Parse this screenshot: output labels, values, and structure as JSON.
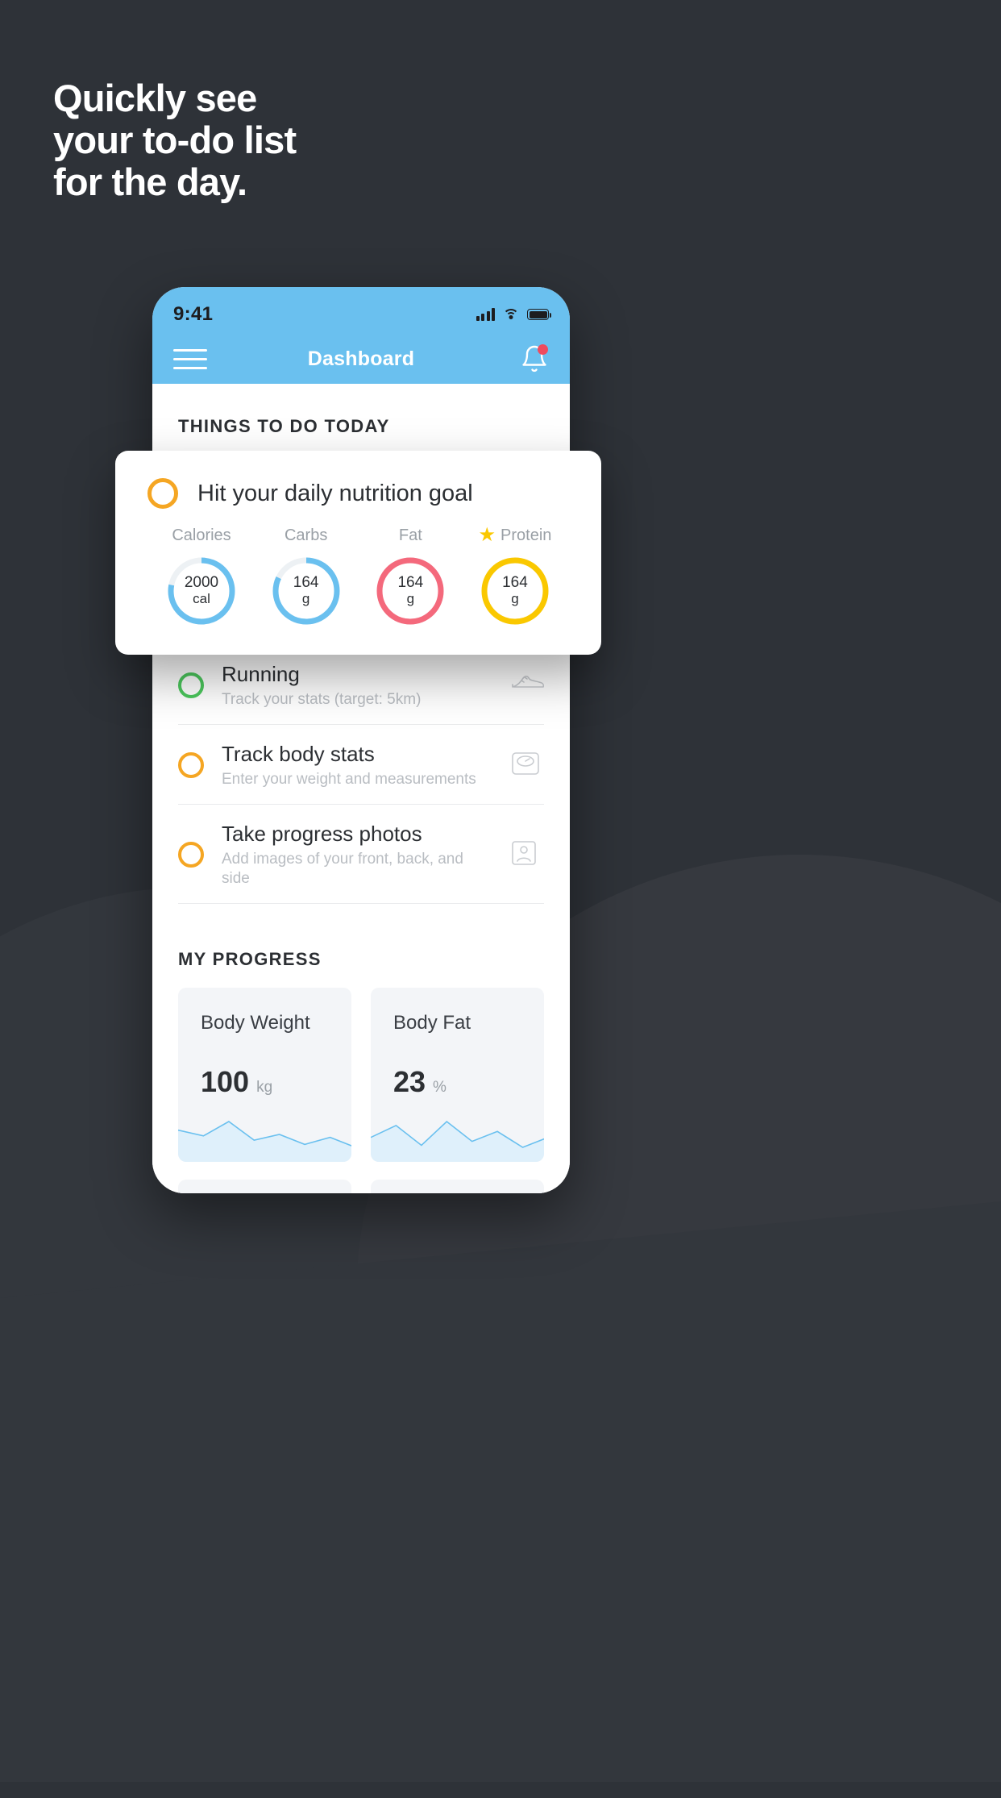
{
  "headline": {
    "lines": [
      "Quickly see",
      "your to-do list",
      "for the day."
    ]
  },
  "colors": {
    "background": "#2e3238",
    "accent_blue": "#6ac0ef",
    "amber": "#f5a623",
    "green": "#4cc85d",
    "red": "#f4697c",
    "yellow": "#fac800",
    "card_grey": "#f3f5f8"
  },
  "phone": {
    "statusbar": {
      "time": "9:41",
      "icons": [
        "signal-icon",
        "wifi-icon",
        "battery-icon"
      ]
    },
    "appbar": {
      "menu_icon": "hamburger-icon",
      "title": "Dashboard",
      "bell_icon": "bell-icon",
      "bell_badge": true
    },
    "things_to_do": {
      "section_title": "THINGS TO DO TODAY",
      "tasks": [
        {
          "title": "Running",
          "subtitle": "Track your stats (target: 5km)",
          "ring_color": "green",
          "icon": "shoe-icon"
        },
        {
          "title": "Track body stats",
          "subtitle": "Enter your weight and measurements",
          "ring_color": "amber",
          "icon": "scale-icon"
        },
        {
          "title": "Take progress photos",
          "subtitle": "Add images of your front, back, and side",
          "ring_color": "amber",
          "icon": "photo-icon"
        }
      ]
    },
    "my_progress": {
      "section_title": "MY PROGRESS",
      "cards": [
        {
          "label": "Body Weight",
          "value": "100",
          "unit": "kg"
        },
        {
          "label": "Body Fat",
          "value": "23",
          "unit": "%"
        }
      ]
    }
  },
  "nutrition_card": {
    "ring_color": "amber",
    "title": "Hit your daily nutrition goal",
    "macros": [
      {
        "label": "Calories",
        "value": "2000",
        "unit": "cal",
        "color": "#6ac0ef",
        "percent": 78,
        "starred": false
      },
      {
        "label": "Carbs",
        "value": "164",
        "unit": "g",
        "color": "#6ac0ef",
        "percent": 82,
        "starred": false
      },
      {
        "label": "Fat",
        "value": "164",
        "unit": "g",
        "color": "#f4697c",
        "percent": 100,
        "starred": false
      },
      {
        "label": "Protein",
        "value": "164",
        "unit": "g",
        "color": "#fac800",
        "percent": 100,
        "starred": true
      }
    ],
    "star_glyph": "★"
  },
  "chart_data": [
    {
      "type": "area",
      "title": "Body Weight",
      "ylabel": "kg",
      "x": [
        0,
        1,
        2,
        3,
        4,
        5,
        6,
        7
      ],
      "values": [
        34,
        30,
        40,
        27,
        31,
        24,
        29,
        22
      ],
      "color": "#6ac0ef",
      "grid": false,
      "legend": "none"
    },
    {
      "type": "area",
      "title": "Body Fat",
      "ylabel": "%",
      "x": [
        0,
        1,
        2,
        3,
        4,
        5,
        6,
        7
      ],
      "values": [
        30,
        36,
        26,
        38,
        28,
        33,
        25,
        30
      ],
      "color": "#6ac0ef",
      "grid": false,
      "legend": "none"
    }
  ]
}
